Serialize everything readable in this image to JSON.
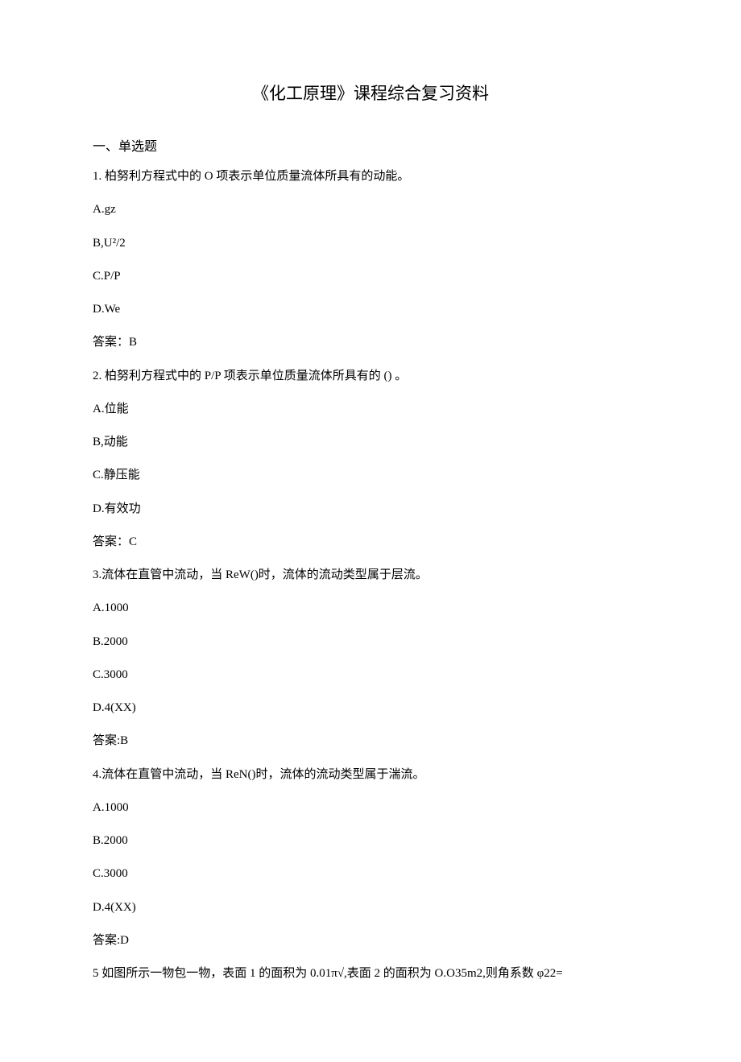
{
  "title": "《化工原理》课程综合复习资料",
  "section_heading": "一、单选题",
  "q1": {
    "prompt": "1. 柏努利方程式中的 O 项表示单位质量流体所具有的动能。",
    "a": "A.gz",
    "b": "B,U²/2",
    "c": "C.P/P",
    "d": "D.We",
    "answer": "答案：B"
  },
  "q2": {
    "prompt": "2. 柏努利方程式中的 P/P 项表示单位质量流体所具有的 () 。",
    "a": "A.位能",
    "b": "B,动能",
    "c": "C.静压能",
    "d": "D.有效功",
    "answer": "答案：C"
  },
  "q3": {
    "prompt": "3.流体在直管中流动，当 ReW()时，流体的流动类型属于层流。",
    "a": "A.1000",
    "b": "B.2000",
    "c": "C.3000",
    "d": "D.4(XX)",
    "answer": "答案:B"
  },
  "q4": {
    "prompt": "4.流体在直管中流动，当 ReN()时，流体的流动类型属于湍流。",
    "a": "A.1000",
    "b": "B.2000",
    "c": "C.3000",
    "d": "D.4(XX)",
    "answer": "答案:D"
  },
  "q5": {
    "prompt": "5 如图所示一物包一物，表面 1 的面积为 0.01π√,表面 2 的面积为 O.O35m2,则角系数 φ22="
  }
}
